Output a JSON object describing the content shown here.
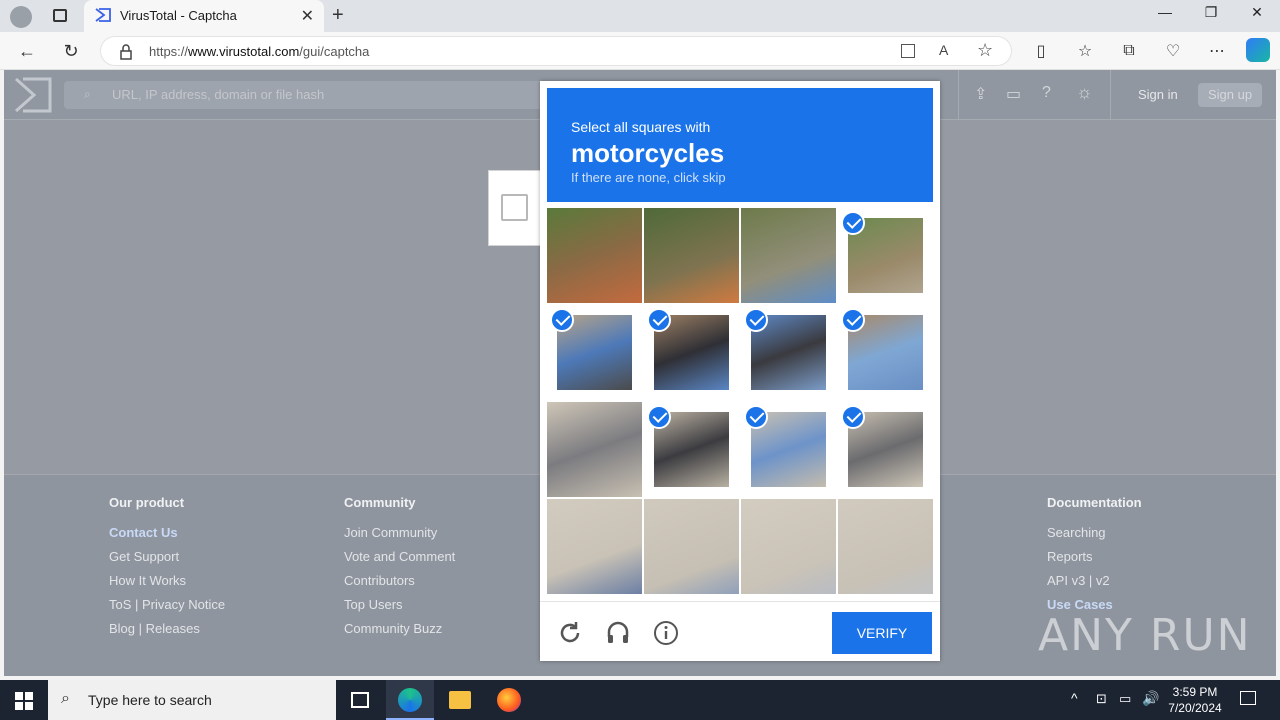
{
  "browser": {
    "tab_title": "VirusTotal - Captcha",
    "url_prefix": "https://",
    "url_domain": "www.virustotal.com",
    "url_path": "/gui/captcha"
  },
  "vt": {
    "search_placeholder": "URL, IP address, domain or file hash",
    "sign_in": "Sign in",
    "sign_up": "Sign up"
  },
  "footer": {
    "product": {
      "heading": "Our product",
      "links": [
        "Contact Us",
        "Get Support",
        "How It Works",
        "ToS | Privacy Notice",
        "Blog | Releases"
      ]
    },
    "community": {
      "heading": "Community",
      "links": [
        "Join Community",
        "Vote and Comment",
        "Contributors",
        "Top Users",
        "Community Buzz"
      ]
    },
    "docs": {
      "heading": "Documentation",
      "links": [
        "Searching",
        "Reports",
        "API v3 | v2",
        "Use Cases"
      ]
    }
  },
  "captcha": {
    "prompt": "Select all squares with",
    "object": "motorcycles",
    "subtext": "If there are none, click skip",
    "verify_label": "VERIFY",
    "selected": [
      false,
      false,
      false,
      true,
      true,
      true,
      true,
      true,
      false,
      true,
      true,
      true,
      false,
      false,
      false,
      false
    ]
  },
  "watermark": "ANY RUN",
  "taskbar": {
    "search_placeholder": "Type here to search",
    "time": "3:59 PM",
    "date": "7/20/2024"
  }
}
